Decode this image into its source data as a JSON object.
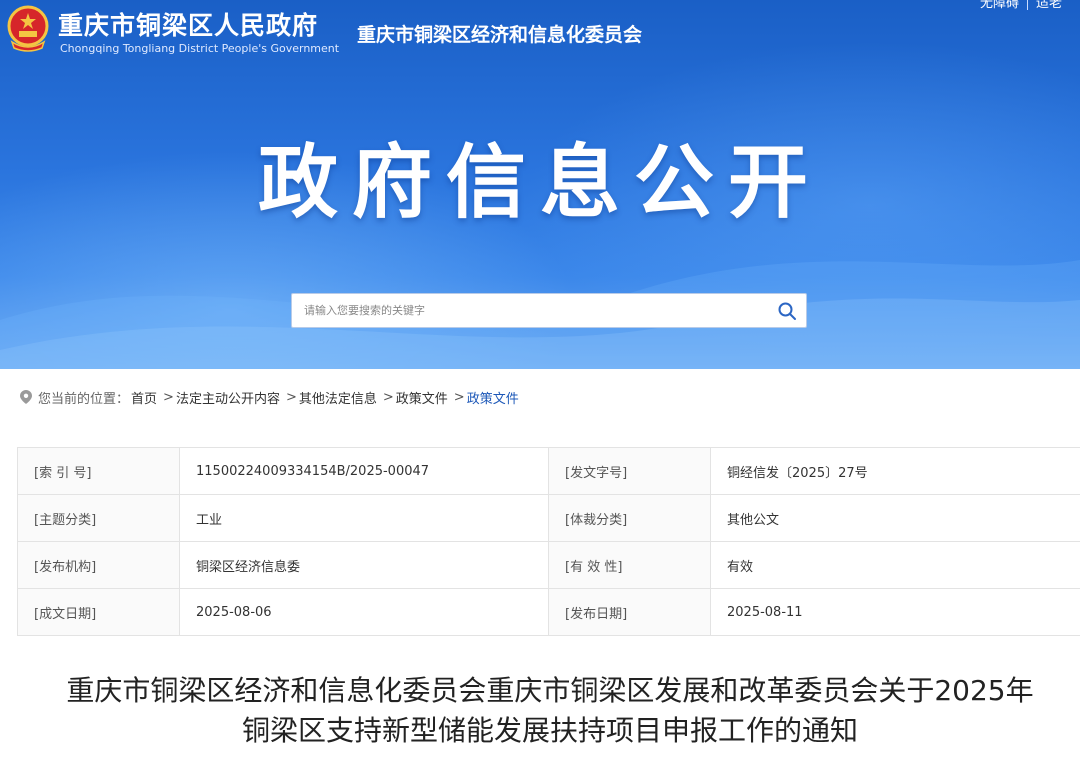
{
  "header": {
    "site_name": "重庆市铜梁区人民政府",
    "site_name_en": "Chongqing Tongliang District People's Government",
    "department": "重庆市铜梁区经济和信息化委员会",
    "top_links": [
      "无障碍",
      "适老"
    ],
    "hero_title": "政府信息公开"
  },
  "search": {
    "placeholder": "请输入您要搜索的关键字",
    "icon": "search-icon"
  },
  "breadcrumb": {
    "label": "您当前的位置：",
    "items": [
      "首页",
      "法定主动公开内容",
      "其他法定信息",
      "政策文件",
      "政策文件"
    ],
    "separator": ">"
  },
  "meta": {
    "rows": [
      [
        {
          "k": "[索 引 号]",
          "v": "11500224009334154B/2025-00047"
        },
        {
          "k": "[发文字号]",
          "v": "铜经信发〔2025〕27号"
        }
      ],
      [
        {
          "k": "[主题分类]",
          "v": "工业"
        },
        {
          "k": "[体裁分类]",
          "v": "其他公文"
        }
      ],
      [
        {
          "k": "[发布机构]",
          "v": "铜梁区经济信息委"
        },
        {
          "k": "[有 效 性]",
          "v": "有效"
        }
      ],
      [
        {
          "k": "[成文日期]",
          "v": "2025-08-06"
        },
        {
          "k": "[发布日期]",
          "v": "2025-08-11"
        }
      ]
    ]
  },
  "article": {
    "title_line1": "重庆市铜梁区经济和信息化委员会重庆市铜梁区发展和改革委员会关于2025年",
    "title_line2": "铜梁区支持新型储能发展扶持项目申报工作的通知"
  },
  "colors": {
    "banner_top": "#1a5fc6",
    "banner_bottom": "#69a8f2",
    "breadcrumb_current": "#1d58b8"
  }
}
